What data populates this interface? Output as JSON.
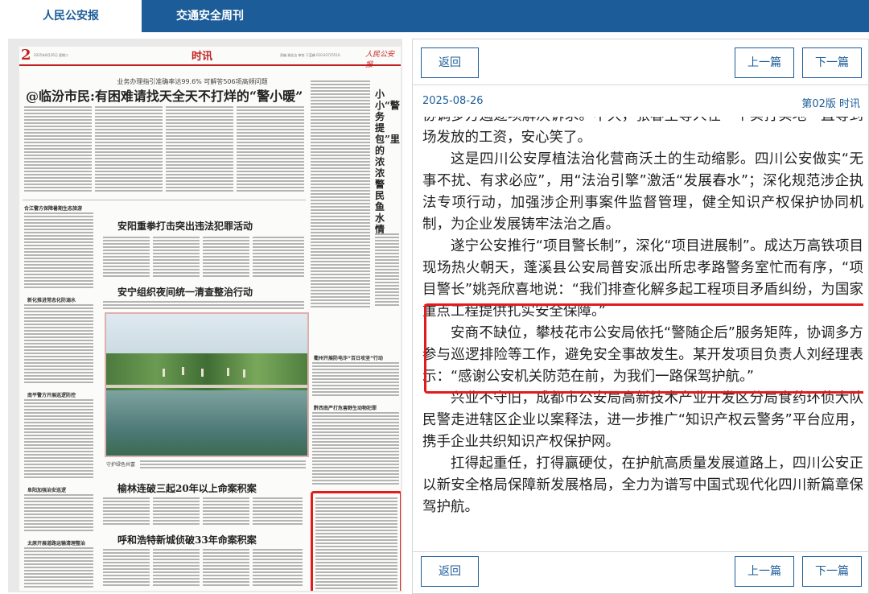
{
  "tabs": [
    {
      "label": "人民公安报",
      "active": true
    },
    {
      "label": "交通安全周刊",
      "active": false
    }
  ],
  "newspaper": {
    "page_number": "2",
    "date_line": "2025年8月26日 星期二",
    "section": "时讯",
    "editors_line": "责编 谢佳洁 审校 于蓝峰 010-83725516",
    "logo": "人民公安报",
    "subhead": "业务办理指引准确率达99.6% 可解答506项高频问题",
    "headline": "@临汾市民:有困难请找天全天不打烊的“警小暖”",
    "vertical_title": "小小“警务提包”里的浓浓警民鱼水情",
    "article_titles": [
      "安阳重拳打击突出违法犯罪活动",
      "安宁组织夜间统一清查整治行动",
      "榆林连破三起20年以上命案积案",
      "呼和浩特新城侦破33年命案积案"
    ],
    "side_titles": [
      "合江警方保障暑期生态旅游",
      "新化推进常态化防溺水",
      "南平警方开展巡逻防控",
      "阜阳加强治安巡逻",
      "衢州开展防电诈“百日攻坚”行动",
      "黔西南严打危害野生动物犯罪",
      "太原开展道路运输清理整治"
    ],
    "photo_caption_label": "守护绿色共富"
  },
  "reader": {
    "back_label": "返回",
    "prev_label": "上一篇",
    "next_label": "下一篇",
    "date": "2025-08-26",
    "page_info": "第02版 时讯",
    "paragraphs": [
      "协调多方遏逐项解决诉求。不久，张春生等人在一个实打实地一直等到场发放的工资，安心笑了。",
      "这是四川公安厚植法治化营商沃土的生动缩影。四川公安做实“无事不扰、有求必应”，用“法治引擎”激活“发展春水”；深化规范涉企执法专项行动，加强涉企刑事案件监督管理，健全知识产权保护协同机制，为企业发展铸牢法治之盾。",
      "遂宁公安推行“项目警长制”，深化“项目进展制”。成达万高铁项目现场热火朝天，蓬溪县公安局普安派出所忠孝路警务室忙而有序，“项目警长”姚尧欣喜地说：“我们排查化解多起工程项目矛盾纠纷，为国家重点工程提供扎实安全保障。”",
      "安商不缺位，攀枝花市公安局依托“警随企后”服务矩阵，协调多方参与巡逻排险等工作，避免安全事故发生。某开发项目负责人刘经理表示：“感谢公安机关防范在前，为我们一路保驾护航。”",
      "兴业不守旧，成都市公安局高新技术产业开发区分局食药环侦大队民警走进辖区企业以案释法，进一步推广“知识产权云警务”平台应用，携手企业共织知识产权保护网。",
      "扛得起重任，打得赢硬仗，在护航高质量发展道路上，四川公安正以新安全格局保障新发展格局，全力为谱写中国式现代化四川新篇章保驾护航。"
    ]
  },
  "colors": {
    "brand_blue": "#1c5d99",
    "highlight_red": "#e21c1c",
    "section_red": "#c01f1f"
  }
}
